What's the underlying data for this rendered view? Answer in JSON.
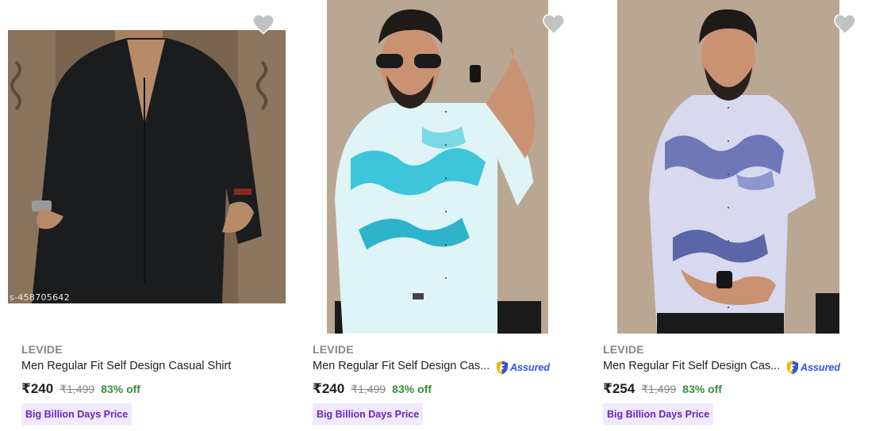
{
  "products": [
    {
      "brand": "LEVIDE",
      "title": "Men Regular Fit Self Design Casual Shirt",
      "price": "₹240",
      "mrp": "₹1,499",
      "discount": "83% off",
      "badge": "Big Billion Days Price",
      "watermark": "s-458705642",
      "image_icon": "black-shirt-photo",
      "wishlisted": false
    },
    {
      "brand": "LEVIDE",
      "title": "Men Regular Fit Self Design Cas...",
      "price": "₹240",
      "mrp": "₹1,499",
      "discount": "83% off",
      "badge": "Big Billion Days Price",
      "assured": "Assured",
      "image_icon": "cyan-print-shirt-photo",
      "wishlisted": false
    },
    {
      "brand": "LEVIDE",
      "title": "Men Regular Fit Self Design Cas...",
      "price": "₹254",
      "mrp": "₹1,499",
      "discount": "83% off",
      "badge": "Big Billion Days Price",
      "assured": "Assured",
      "image_icon": "blue-print-shirt-photo",
      "wishlisted": false
    }
  ],
  "colors": {
    "brand_grey": "#878787",
    "discount_green": "#388e3c",
    "badge_bg": "#f1eafe",
    "badge_text": "#6b22c7",
    "assured_blue": "#2a55e5",
    "heart_grey": "#c2c2c2"
  }
}
